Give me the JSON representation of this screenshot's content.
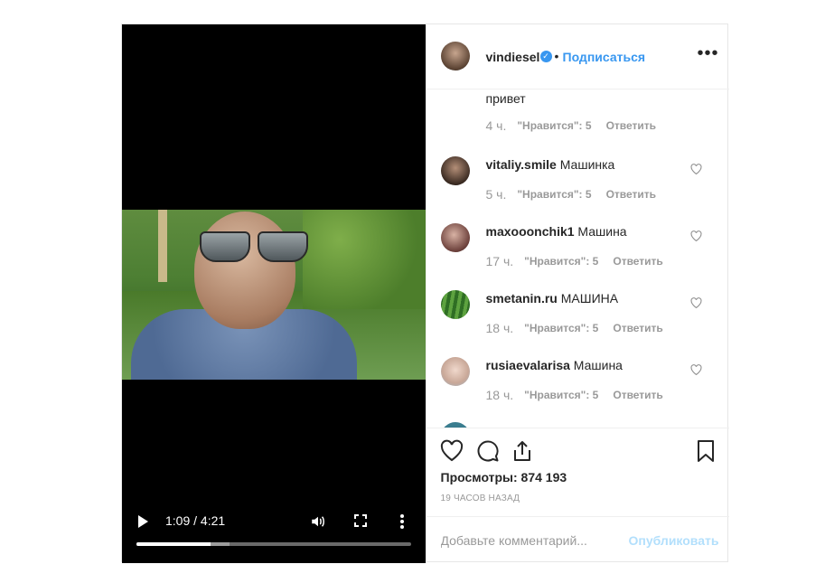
{
  "video": {
    "time": "1:09 / 4:21",
    "progress_played": 0.27,
    "progress_buffered": 0.34
  },
  "header": {
    "username": "vindiesel",
    "separator": "•",
    "follow_label": "Подписаться"
  },
  "comments": {
    "top_partial": {
      "text": "привет",
      "ago": "4 ч.",
      "likes": "\"Нравится\": 5",
      "reply": "Ответить"
    },
    "items": [
      {
        "user": "vitaliy.smile",
        "text": "Машинка",
        "ago": "5 ч.",
        "likes": "\"Нравится\": 5",
        "reply": "Ответить"
      },
      {
        "user": "maxooonchik1",
        "text": "Машина",
        "ago": "17 ч.",
        "likes": "\"Нравится\": 5",
        "reply": "Ответить"
      },
      {
        "user": "smetanin.ru",
        "text": "МАШИНА",
        "ago": "18 ч.",
        "likes": "\"Нравится\": 5",
        "reply": "Ответить"
      },
      {
        "user": "rusiaevalarisa",
        "text": "Машина",
        "ago": "18 ч.",
        "likes": "\"Нравится\": 5",
        "reply": "Ответить"
      }
    ]
  },
  "stats": {
    "views": "Просмотры: 874 193",
    "posted": "19 ЧАСОВ НАЗАД"
  },
  "comment_box": {
    "placeholder": "Добавьте комментарий...",
    "publish_label": "Опубликовать"
  },
  "colors": {
    "accent": "#3897f0",
    "publish_disabled": "#b2dffc",
    "meta_gray": "#999999"
  }
}
